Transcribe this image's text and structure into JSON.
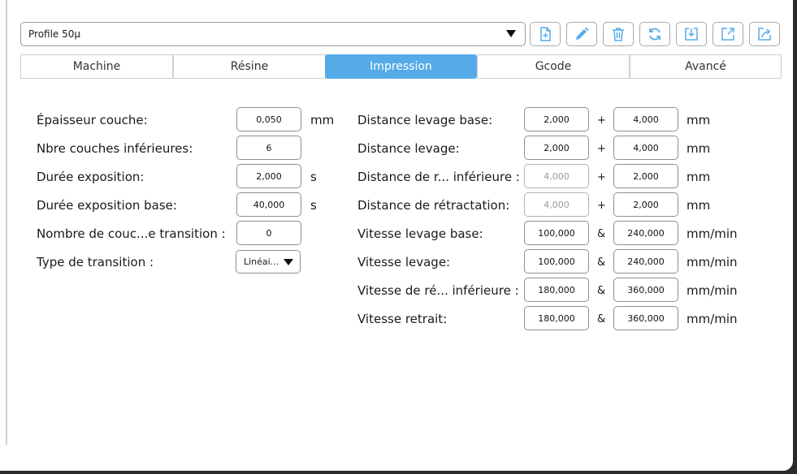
{
  "profile": {
    "selected": "Profile 50µ"
  },
  "toolbar": {
    "icons": [
      "new-profile-icon",
      "edit-profile-icon",
      "delete-profile-icon",
      "refresh-icon",
      "import-icon",
      "export-icon",
      "share-icon"
    ],
    "accent": "#55abe8"
  },
  "tabs": [
    {
      "label": "Machine",
      "active": false
    },
    {
      "label": "Résine",
      "active": false
    },
    {
      "label": "Impression",
      "active": true
    },
    {
      "label": "Gcode",
      "active": false
    },
    {
      "label": "Avancé",
      "active": false
    }
  ],
  "left": {
    "rows": [
      {
        "label": "Épaisseur couche:",
        "value": "0,050",
        "unit": "mm"
      },
      {
        "label": "Nbre couches inférieures:",
        "value": "6",
        "unit": ""
      },
      {
        "label": "Durée exposition:",
        "value": "2,000",
        "unit": "s"
      },
      {
        "label": "Durée exposition base:",
        "value": "40,000",
        "unit": "s"
      },
      {
        "label": "Nombre de couc...e transition :",
        "value": "0",
        "unit": ""
      }
    ],
    "transition": {
      "label": "Type de transition :",
      "value": "Linéai..."
    }
  },
  "right": {
    "rows": [
      {
        "label": "Distance levage base:",
        "v1": "2,000",
        "op": "+",
        "v2": "4,000",
        "unit": "mm"
      },
      {
        "label": "Distance levage:",
        "v1": "2,000",
        "op": "+",
        "v2": "4,000",
        "unit": "mm"
      },
      {
        "label": "Distance de r... inférieure :",
        "v1": "4,000",
        "op": "+",
        "v2": "2,000",
        "unit": "mm"
      },
      {
        "label": "Distance de rétractation:",
        "v1": "4,000",
        "op": "+",
        "v2": "2,000",
        "unit": "mm"
      },
      {
        "label": "Vitesse levage base:",
        "v1": "100,000",
        "op": "&",
        "v2": "240,000",
        "unit": "mm/min"
      },
      {
        "label": "Vitesse levage:",
        "v1": "100,000",
        "op": "&",
        "v2": "240,000",
        "unit": "mm/min"
      },
      {
        "label": "Vitesse de ré... inférieure :",
        "v1": "180,000",
        "op": "&",
        "v2": "360,000",
        "unit": "mm/min"
      },
      {
        "label": "Vitesse retrait:",
        "v1": "180,000",
        "op": "&",
        "v2": "360,000",
        "unit": "mm/min"
      }
    ]
  }
}
